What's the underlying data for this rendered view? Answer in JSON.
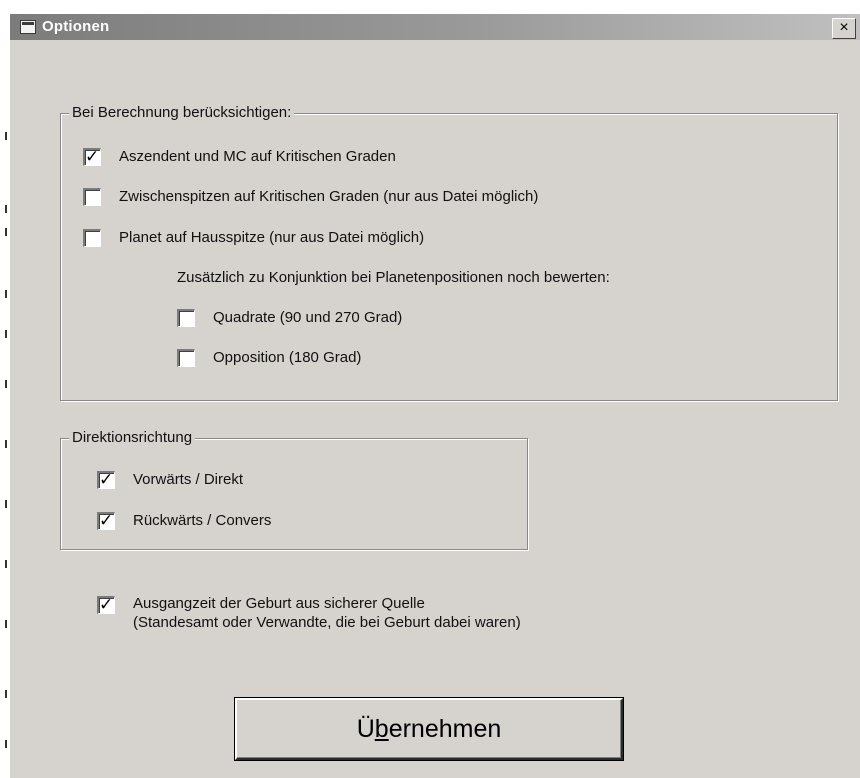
{
  "window": {
    "title": "Optionen",
    "close_glyph": "×"
  },
  "icons": {
    "window": "window-icon",
    "close": "close-icon"
  },
  "groups": {
    "berechnung": {
      "label": "Bei Berechnung berücksichtigen:",
      "options": [
        {
          "label": "Aszendent und MC auf Kritischen Graden",
          "checked": true
        },
        {
          "label": "Zwischenspitzen auf Kritischen Graden (nur aus Datei möglich)",
          "checked": false
        },
        {
          "label": "Planet auf Hausspitze (nur aus Datei möglich)",
          "checked": false
        }
      ],
      "sub_heading": "Zusätzlich zu Konjunktion bei Planetenpositionen noch bewerten:",
      "sub_options": [
        {
          "label": "Quadrate (90 und 270 Grad)",
          "checked": false
        },
        {
          "label": "Opposition (180 Grad)",
          "checked": false
        }
      ]
    },
    "direktion": {
      "label": "Direktionsrichtung",
      "options": [
        {
          "label": "Vorwärts / Direkt",
          "checked": true
        },
        {
          "label": "Rückwärts / Convers",
          "checked": true
        }
      ]
    }
  },
  "birth_source": {
    "line1": "Ausgangzeit der Geburt aus sicherer Quelle",
    "line2": "(Standesamt oder Verwandte, die bei Geburt dabei waren)",
    "checked": true
  },
  "apply_button": {
    "pre": "Ü",
    "mnemonic": "b",
    "post": "ernehmen"
  },
  "colors": {
    "dialog_bg": "#d6d3ce",
    "titlebar_inactive": "#808080",
    "title_text": "#ffffff"
  }
}
